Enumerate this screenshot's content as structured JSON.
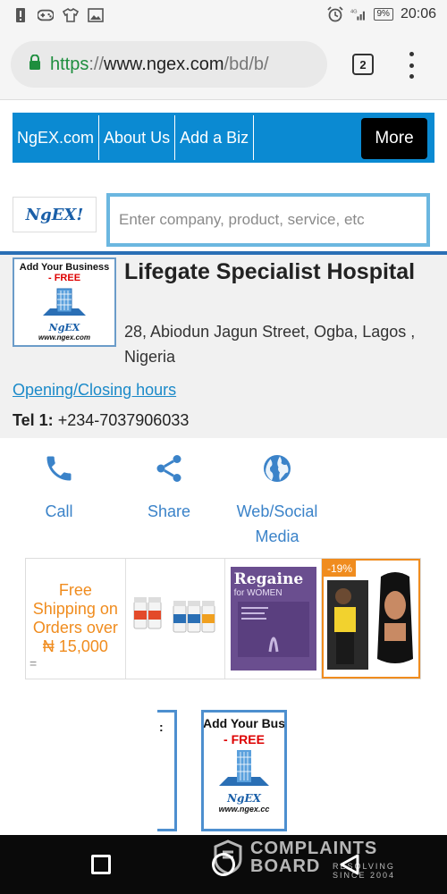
{
  "status_bar": {
    "time": "20:06",
    "battery": "9%",
    "network": "4G"
  },
  "browser": {
    "url_scheme": "https",
    "url_separator": "://",
    "url_host": "www.ngex.com",
    "url_path": "/bd/b/",
    "tab_count": "2"
  },
  "nav": {
    "items": [
      "NgEX.com",
      "About Us",
      "Add a Biz"
    ],
    "more_label": "More"
  },
  "site": {
    "logo_text": "NgEX!"
  },
  "search": {
    "placeholder": "Enter company, product, service, etc"
  },
  "business": {
    "thumb_line1": "Add Your Business",
    "thumb_line2": "- FREE",
    "thumb_logo": "NgEX",
    "thumb_url": "www.ngex.com",
    "name": "Lifegate Specialist Hospital",
    "address": "28, Abiodun Jagun Street, Ogba, Lagos , Nigeria",
    "hours_link": "Opening/Closing hours",
    "tel_label": "Tel 1:",
    "tel_value": "+234-7037906033"
  },
  "actions": {
    "call": "Call",
    "share": "Share",
    "web": "Web/Social\nMedia"
  },
  "ads": {
    "free_shipping": "Free Shipping on Orders over ₦ 15,000",
    "eq": "=",
    "regaine_title": "Regaine",
    "regaine_sub": "for WOMEN",
    "discount": "-19%"
  },
  "banners": {
    "line1": "Add Your Bus",
    "line2": "- FREE",
    "logo": "NgEX",
    "url": "www.ngex.cc",
    "partial_char": ":"
  },
  "watermark": {
    "line1": "COMPLAINTS",
    "line2": "BOARD",
    "small": "RESOLVING SINCE 2004"
  },
  "colors": {
    "nav_blue": "#0b8ad2",
    "link_blue": "#1b8ac9",
    "accent_orange": "#f08c1e",
    "url_green": "#1e8e3e"
  }
}
